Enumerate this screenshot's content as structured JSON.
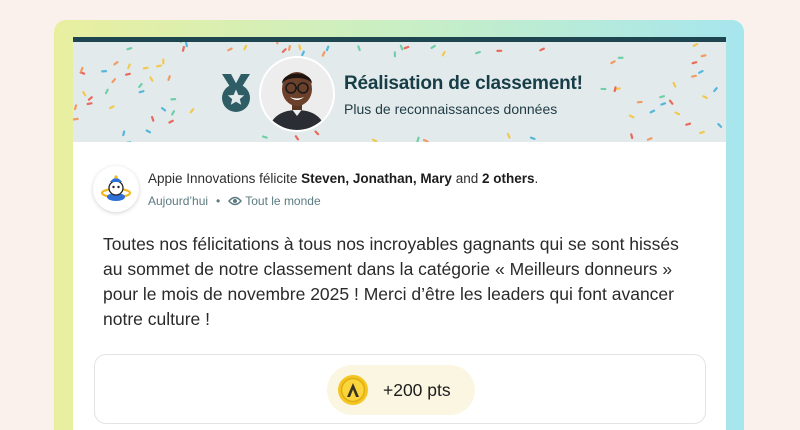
{
  "banner": {
    "title": "Réalisation de classement!",
    "subtitle": "Plus de reconnaissances données"
  },
  "post": {
    "company": "Appie Innovations",
    "verb": "félicite",
    "recipients": "Steven, Jonathan, Mary",
    "conjunction": "and",
    "others": "2 others",
    "period": ".",
    "time": "Aujourd’hui",
    "separator": "•",
    "audience": "Tout le monde",
    "message": "Toutes nos félicitations à tous nos incroyables gagnants qui se sont hissés au sommet de notre classement dans la catégorie « Meilleurs donneurs » pour le mois de novembre 2025 ! Merci d’être les leaders qui font avancer notre culture !"
  },
  "reward": {
    "points": "+200 pts"
  },
  "icons": {
    "medal": "medal-icon",
    "eye": "eye-icon",
    "coin": "points-coin-icon",
    "logo": "appie-logo"
  },
  "colors": {
    "header_bar": "#1e4650",
    "title": "#173e47",
    "coin": "#f3c623"
  }
}
